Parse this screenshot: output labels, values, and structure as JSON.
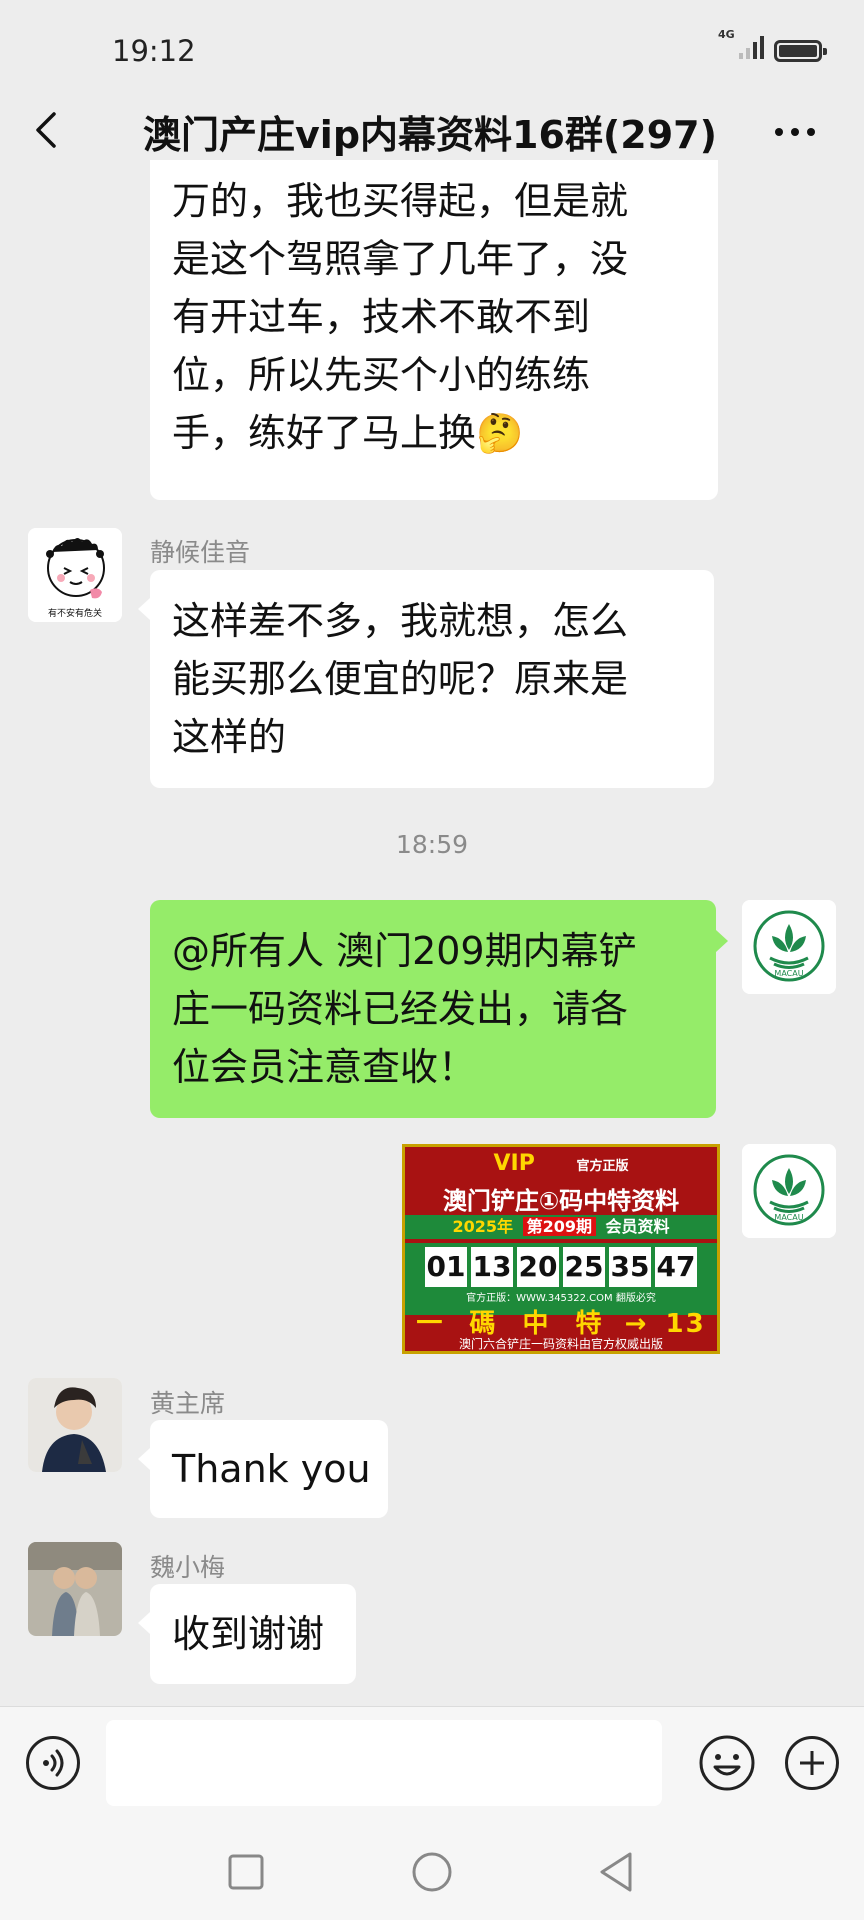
{
  "status_bar": {
    "time": "19:12",
    "network": "4G"
  },
  "header": {
    "title": "澳门产庄vip内幕资料16群(297)"
  },
  "messages": {
    "m1": {
      "lines": [
        "万的，我也买得起，但是就",
        "是这个驾照拿了几年了，没",
        "有开过车，技术不敢不到",
        "位，所以先买个小的练练",
        "手，练好了马上换🤔"
      ]
    },
    "m2": {
      "sender": "静候佳音",
      "lines": [
        "这样差不多，我就想，怎么",
        "能买那么便宜的呢？原来是",
        "这样的"
      ],
      "avatar_text": "有不安有危关"
    },
    "timestamp": "18:59",
    "m3": {
      "lines": [
        "@所有人 澳门209期内幕铲",
        "庄一码资料已经发出，请各",
        "位会员注意查收！"
      ]
    },
    "m4": {
      "image": {
        "vip": "VIP",
        "official": "官方正版",
        "title": "澳门铲庄①码中特资料",
        "year": "2025年",
        "period": "第209期",
        "member": "会员资料",
        "numbers": [
          "01",
          "13",
          "20",
          "25",
          "35",
          "47"
        ],
        "site": "官方正版：WWW.345322.COM 翻版必究",
        "slogan": [
          "一",
          "碼",
          "中",
          "特",
          "→",
          "13"
        ],
        "footer": "澳门六合铲庄一码资料由官方权威出版"
      }
    },
    "m5": {
      "sender": "黄主席",
      "text": "Thank you"
    },
    "m6": {
      "sender": "魏小梅",
      "text": "收到谢谢"
    }
  },
  "macau_logo": {
    "text": "MACAU"
  },
  "colors": {
    "background": "#ededed",
    "green_bubble": "#95ec69",
    "white_bubble": "#ffffff"
  },
  "icons": [
    "back-icon",
    "more-icon",
    "voice-icon",
    "emoji-icon",
    "plus-icon",
    "nav-square-icon",
    "nav-home-icon",
    "nav-back-icon"
  ]
}
